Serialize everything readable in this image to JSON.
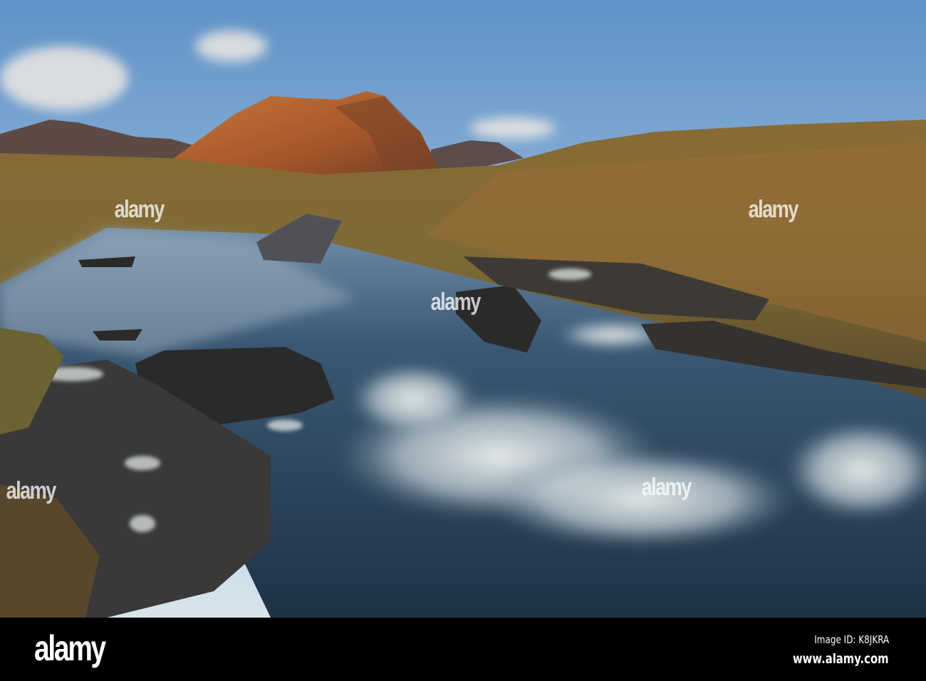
{
  "image": {
    "description_colors": {
      "sky_top": "#5f92c8",
      "sky_horizon": "#d8e4ea",
      "mountain_lit": "#b5622c",
      "moor": "#8a6a35",
      "water": "#2b4660",
      "foam": "#e6ece9",
      "rock": "#2a2a2c"
    }
  },
  "watermark": {
    "logo": "alamy",
    "image_id": "Image ID: K8JKRA",
    "website": "www.alamy.com"
  }
}
